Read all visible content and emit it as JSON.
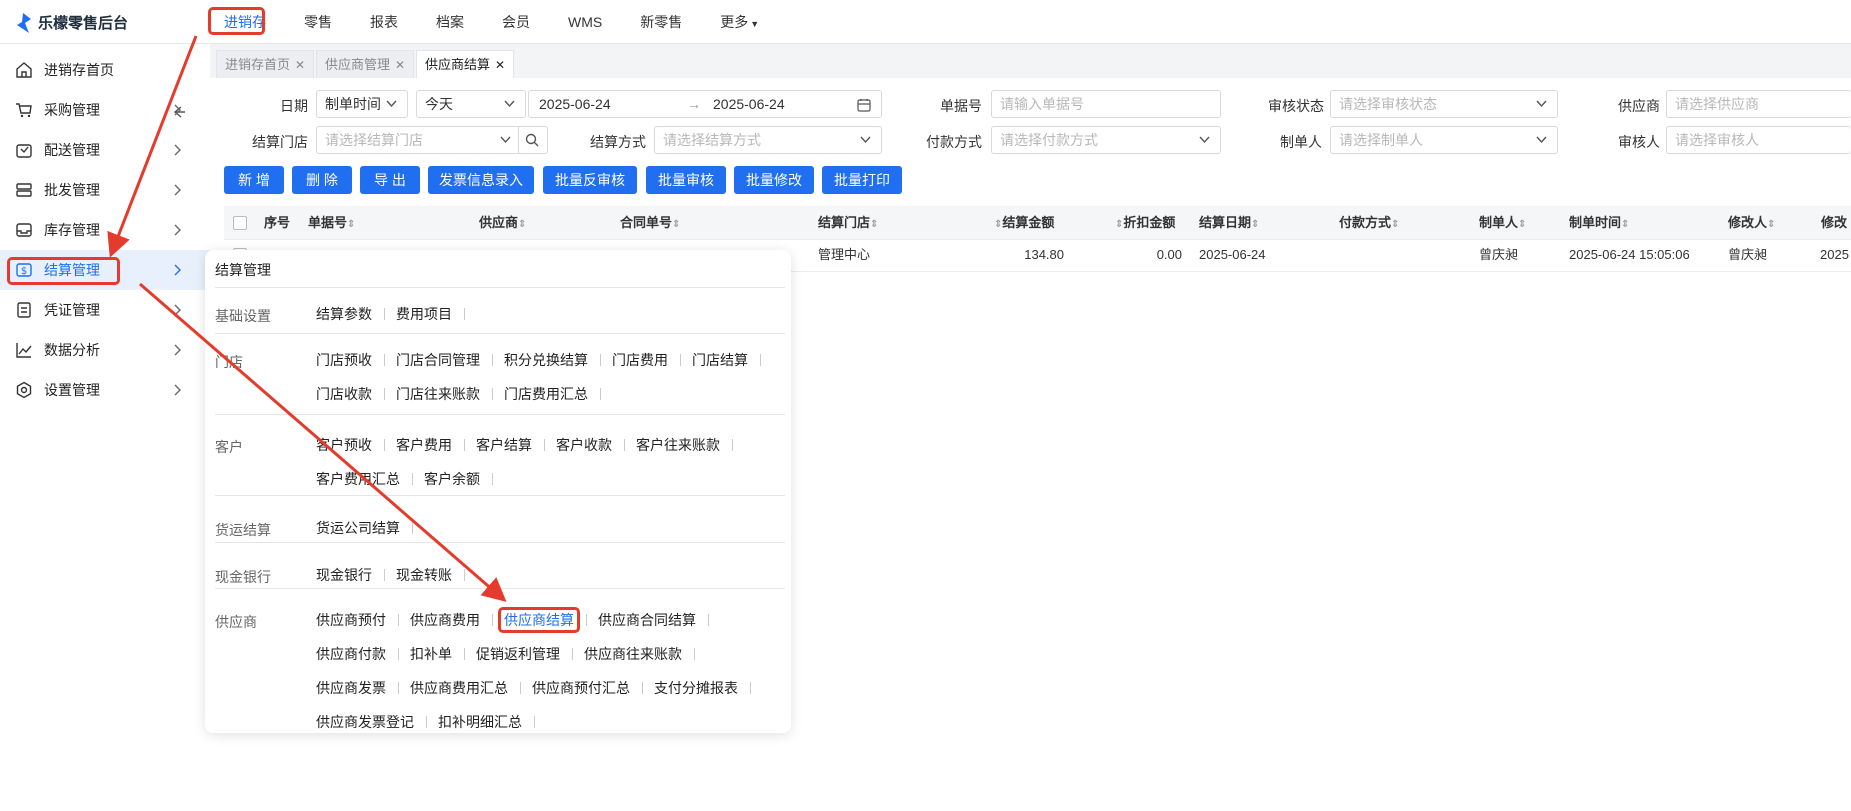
{
  "app": {
    "title": "乐檬零售后台"
  },
  "topnav": [
    {
      "label": "进销存",
      "active": true
    },
    {
      "label": "零售"
    },
    {
      "label": "报表"
    },
    {
      "label": "档案"
    },
    {
      "label": "会员"
    },
    {
      "label": "WMS"
    },
    {
      "label": "新零售"
    },
    {
      "label": "更多"
    }
  ],
  "sidebar": {
    "items": [
      {
        "label": "进销存首页",
        "icon": "home-icon"
      },
      {
        "label": "采购管理",
        "icon": "cart-icon"
      },
      {
        "label": "配送管理",
        "icon": "box-icon"
      },
      {
        "label": "批发管理",
        "icon": "server-icon"
      },
      {
        "label": "库存管理",
        "icon": "inbox-icon"
      },
      {
        "label": "结算管理",
        "icon": "dollar-icon",
        "active": true
      },
      {
        "label": "凭证管理",
        "icon": "doc-icon"
      },
      {
        "label": "数据分析",
        "icon": "chart-icon"
      },
      {
        "label": "设置管理",
        "icon": "settings-icon"
      }
    ]
  },
  "tabs": [
    {
      "label": "进销存首页"
    },
    {
      "label": "供应商管理"
    },
    {
      "label": "供应商结算",
      "active": true
    }
  ],
  "filters": {
    "date_label": "日期",
    "date_type": "制单时间",
    "date_range": "今天",
    "date_start": "2025-06-24",
    "date_end": "2025-06-24",
    "bill_no_label": "单据号",
    "bill_no_ph": "请输入单据号",
    "audit_label": "审核状态",
    "audit_ph": "请选择审核状态",
    "supplier_label": "供应商",
    "supplier_ph": "请选择供应商",
    "store_label": "结算门店",
    "store_ph": "请选择结算门店",
    "method_label": "结算方式",
    "method_ph": "请选择结算方式",
    "pay_label": "付款方式",
    "pay_ph": "请选择付款方式",
    "maker_label": "制单人",
    "maker_ph": "请选择制单人",
    "auditor_label": "审核人",
    "auditor_ph": "请选择审核人"
  },
  "buttons": [
    "新 增",
    "删 除",
    "导 出",
    "发票信息录入",
    "批量反审核",
    "批量审核",
    "批量修改",
    "批量打印"
  ],
  "table": {
    "headers": [
      "序号",
      "单据号",
      "供应商",
      "合同单号",
      "结算门店",
      "结算金额",
      "折扣金额",
      "结算日期",
      "付款方式",
      "制单人",
      "制单时间",
      "修改人",
      "修改"
    ],
    "row": {
      "store": "管理中心",
      "amount": "134.80",
      "discount": "0.00",
      "date": "2025-06-24",
      "maker": "曾庆昶",
      "make_time": "2025-06-24 15:05:06",
      "modifier": "曾庆昶",
      "modify": "2025"
    }
  },
  "flyout": {
    "title": "结算管理",
    "sections": [
      {
        "label": "基础设置",
        "rows": [
          [
            "结算参数",
            "费用项目"
          ]
        ]
      },
      {
        "label": "门店",
        "rows": [
          [
            "门店预收",
            "门店合同管理",
            "积分兑换结算",
            "门店费用",
            "门店结算"
          ],
          [
            "门店收款",
            "门店往来账款",
            "门店费用汇总"
          ]
        ]
      },
      {
        "label": "客户",
        "rows": [
          [
            "客户预收",
            "客户费用",
            "客户结算",
            "客户收款",
            "客户往来账款"
          ],
          [
            "客户费用汇总",
            "客户余额"
          ]
        ]
      },
      {
        "label": "货运结算",
        "rows": [
          [
            "货运公司结算"
          ]
        ]
      },
      {
        "label": "现金银行",
        "rows": [
          [
            "现金银行",
            "现金转账"
          ]
        ]
      },
      {
        "label": "供应商",
        "rows": [
          [
            "供应商预付",
            "供应商费用",
            "供应商结算",
            "供应商合同结算"
          ],
          [
            "供应商付款",
            "扣补单",
            "促销返利管理",
            "供应商往来账款"
          ],
          [
            "供应商发票",
            "供应商费用汇总",
            "供应商预付汇总",
            "支付分摊报表"
          ],
          [
            "供应商发票登记",
            "扣补明细汇总"
          ]
        ]
      }
    ]
  },
  "colors": {
    "accent": "#1f6ff0",
    "highlight": "#e53b2c"
  }
}
